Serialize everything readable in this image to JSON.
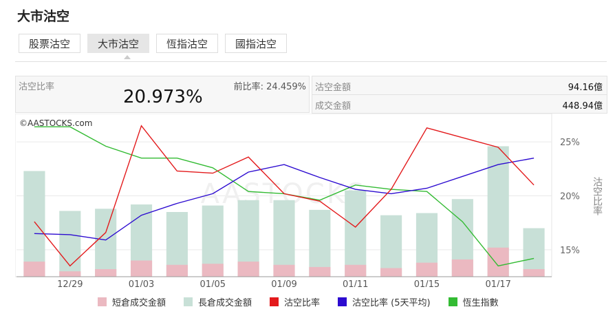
{
  "page": {
    "title": "大市沽空",
    "tabs": [
      "股票沽空",
      "大市沽空",
      "恆指沽空",
      "國指沽空"
    ],
    "active_tab": 1
  },
  "summary": {
    "ratio_label": "沽空比率",
    "ratio_value": "20.973%",
    "prev_label": "前比率:",
    "prev_value": "24.459%",
    "short_amount_label": "沽空金額",
    "short_amount_value": "94.16億",
    "turnover_label": "成交金額",
    "turnover_value": "448.94億"
  },
  "colors": {
    "short_bar": "#ebb9c1",
    "long_bar": "#c8e0d7",
    "ratio_line": "#e31a1c",
    "ratio_avg_line": "#2c0bd0",
    "hsi_line": "#33bb33"
  },
  "chart_data": {
    "type": "bar",
    "watermark": "©AASTOCKS.com",
    "x_tick_labels": [
      "12/29",
      "01/03",
      "01/05",
      "01/09",
      "01/11",
      "01/15",
      "01/17"
    ],
    "y_right_label": "沽空比率",
    "y_right_ticks": [
      "15%",
      "20%",
      "25%"
    ],
    "ylim_right": [
      12.5,
      27.5
    ],
    "series": [
      {
        "name": "短倉成交金額",
        "type": "bar",
        "values": [
          13.9,
          13.0,
          13.2,
          14.0,
          13.6,
          13.7,
          13.9,
          13.6,
          13.4,
          13.6,
          13.3,
          13.8,
          14.1,
          15.2,
          13.2
        ]
      },
      {
        "name": "長倉成交金額",
        "type": "bar",
        "values": [
          22.3,
          18.6,
          18.8,
          19.2,
          18.5,
          19.1,
          19.6,
          19.6,
          18.7,
          20.5,
          18.2,
          18.4,
          19.7,
          24.6,
          17.0
        ]
      },
      {
        "name": "沽空比率",
        "type": "line",
        "values": [
          17.6,
          13.5,
          16.6,
          26.5,
          22.3,
          22.1,
          23.6,
          20.2,
          19.5,
          17.1,
          20.6,
          26.3,
          25.4,
          24.5,
          21.0
        ]
      },
      {
        "name": "沽空比率 (5天平均)",
        "type": "line",
        "values": [
          16.5,
          16.4,
          15.9,
          18.2,
          19.3,
          20.2,
          22.2,
          22.9,
          21.7,
          20.6,
          20.2,
          20.7,
          21.8,
          22.9,
          23.5
        ]
      },
      {
        "name": "恆生指數",
        "type": "line",
        "values": [
          26.4,
          26.4,
          24.6,
          23.5,
          23.5,
          22.6,
          20.4,
          20.2,
          19.6,
          21.0,
          20.6,
          20.4,
          17.6,
          13.5,
          14.2
        ]
      }
    ],
    "grid": true,
    "legend_position": "bottom"
  }
}
